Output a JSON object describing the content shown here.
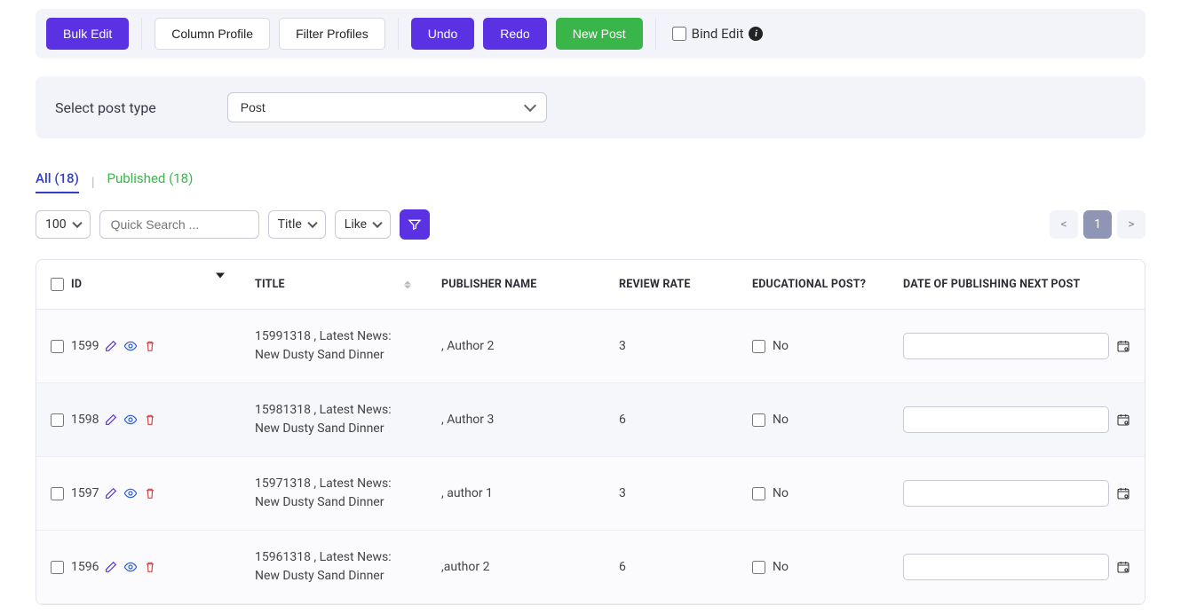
{
  "toolbar": {
    "bulk_edit": "Bulk Edit",
    "column_profile": "Column Profile",
    "filter_profiles": "Filter Profiles",
    "undo": "Undo",
    "redo": "Redo",
    "new_post": "New Post",
    "bind_edit": "Bind Edit"
  },
  "post_type": {
    "label": "Select post type",
    "selected": "Post"
  },
  "status_tabs": {
    "all": "All (18)",
    "published": "Published (18)"
  },
  "filters": {
    "page_size": "100",
    "quick_search_placeholder": "Quick Search ...",
    "search_field": "Title",
    "search_op": "Like"
  },
  "pagination": {
    "prev": "<",
    "current": "1",
    "next": ">"
  },
  "columns": {
    "id": "ID",
    "title": "TITLE",
    "publisher": "PUBLISHER NAME",
    "rate": "REVIEW RATE",
    "edu": "EDUCATIONAL POST?",
    "date": "DATE OF PUBLISHING NEXT POST"
  },
  "rows": [
    {
      "id": "1599",
      "title": "15991318 , Latest News: New Dusty Sand Dinner",
      "publisher": ", Author 2",
      "rate": "3",
      "edu_label": "No",
      "date": ""
    },
    {
      "id": "1598",
      "title": "15981318 , Latest News: New Dusty Sand Dinner",
      "publisher": ", Author 3",
      "rate": "6",
      "edu_label": "No",
      "date": ""
    },
    {
      "id": "1597",
      "title": "15971318 , Latest News: New Dusty Sand Dinner",
      "publisher": ", author 1",
      "rate": "3",
      "edu_label": "No",
      "date": ""
    },
    {
      "id": "1596",
      "title": "15961318 , Latest News: New Dusty Sand Dinner",
      "publisher": ",author 2",
      "rate": "6",
      "edu_label": "No",
      "date": ""
    }
  ]
}
